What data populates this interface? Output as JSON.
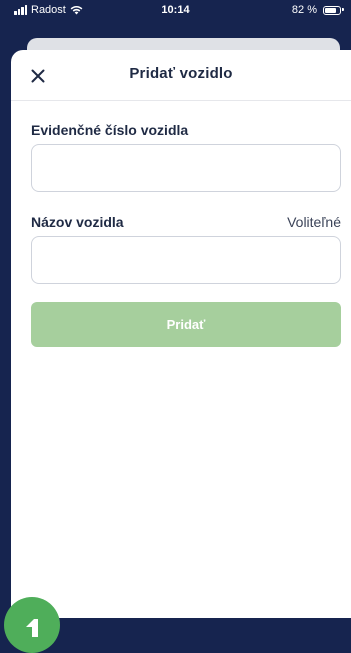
{
  "status_bar": {
    "carrier": "Radost",
    "time": "10:14",
    "battery": "82 %",
    "battery_level": 0.82
  },
  "sheet": {
    "title": "Pridať vozidlo",
    "close_icon": "close-icon"
  },
  "form": {
    "plate": {
      "label": "Evidenčné číslo vozidla",
      "value": "",
      "placeholder": ""
    },
    "name": {
      "label": "Názov vozidla",
      "optional": "Voliteľné",
      "value": "",
      "placeholder": ""
    },
    "submit_label": "Pridať"
  },
  "colors": {
    "background": "#16244f",
    "submit_disabled": "#a6cf9d",
    "fab": "#4fae5a"
  }
}
